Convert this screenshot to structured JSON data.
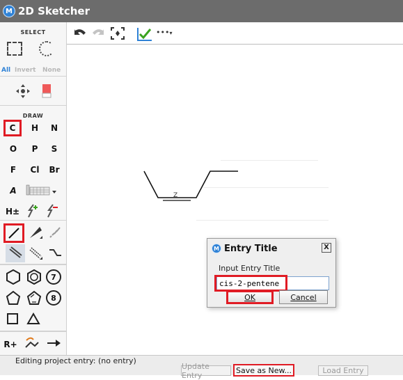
{
  "window": {
    "title": "2D Sketcher",
    "logo_letter": "M"
  },
  "palette": {
    "select_header": "SELECT",
    "select_options": [
      "All",
      "Invert",
      "None"
    ],
    "draw_header": "DRAW",
    "elements": [
      "C",
      "H",
      "N",
      "O",
      "P",
      "S",
      "F",
      "Cl",
      "Br"
    ],
    "atom_label_tool": "A",
    "charge_tool": "H±",
    "ring_seven_label": "7",
    "ring_eight_label": "8",
    "reaction_plus": "R+"
  },
  "toolbar": {
    "more_label": "•••"
  },
  "canvas": {
    "bond_annotation": "Z"
  },
  "dialog": {
    "title": "Entry Title",
    "close_label": "X",
    "prompt": "Input Entry Title",
    "input_value": "cis-2-pentene",
    "ok_label": "OK",
    "cancel_label": "Cancel"
  },
  "statusbar": {
    "text": "Editing project entry: (no entry)",
    "buttons": {
      "update": "Update Entry",
      "save_new": "Save as New...",
      "load": "Load Entry"
    }
  },
  "colors": {
    "highlight": "#e01b24",
    "accent": "#2f82d6",
    "check": "#3aa31f"
  }
}
